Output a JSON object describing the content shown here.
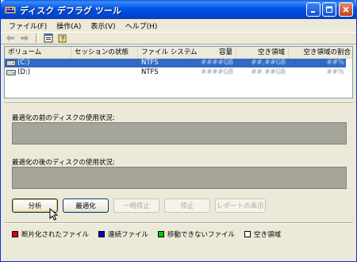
{
  "window": {
    "title": "ディスク デフラグ ツール"
  },
  "menu": [
    "ファイル(F)",
    "操作(A)",
    "表示(V)",
    "ヘルプ(H)"
  ],
  "columns": [
    "ボリューム",
    "セッションの状態",
    "ファイル システム",
    "容量",
    "空き領域",
    "空き領域の割合"
  ],
  "volumes": [
    {
      "name": "(C:)",
      "session": "",
      "fs": "NTFS",
      "capacity": "####GB",
      "free": "##.##GB",
      "pct": "##%",
      "selected": true
    },
    {
      "name": "(D:)",
      "session": "",
      "fs": "NTFS",
      "capacity": "####GB",
      "free": "##.##GB",
      "pct": "##%",
      "selected": false
    }
  ],
  "panels": {
    "before_label": "最適化の前のディスクの使用状況:",
    "after_label": "最適化の後のディスクの使用状況:"
  },
  "buttons": {
    "analyze": "分析",
    "defrag": "最適化",
    "pause": "一時停止",
    "stop": "停止",
    "report": "レポートの表示"
  },
  "legend": [
    {
      "label": "断片化されたファイル",
      "color": "#e00000"
    },
    {
      "label": "連続ファイル",
      "color": "#0000c8"
    },
    {
      "label": "移動できないファイル",
      "color": "#00c800"
    },
    {
      "label": "空き領域",
      "color": "#ffffff"
    }
  ],
  "icons": {
    "app": "defrag-app-icon",
    "back": "back-arrow-icon",
    "forward": "forward-arrow-icon",
    "properties": "properties-icon",
    "help": "help-icon",
    "drive": "hard-drive-icon"
  }
}
